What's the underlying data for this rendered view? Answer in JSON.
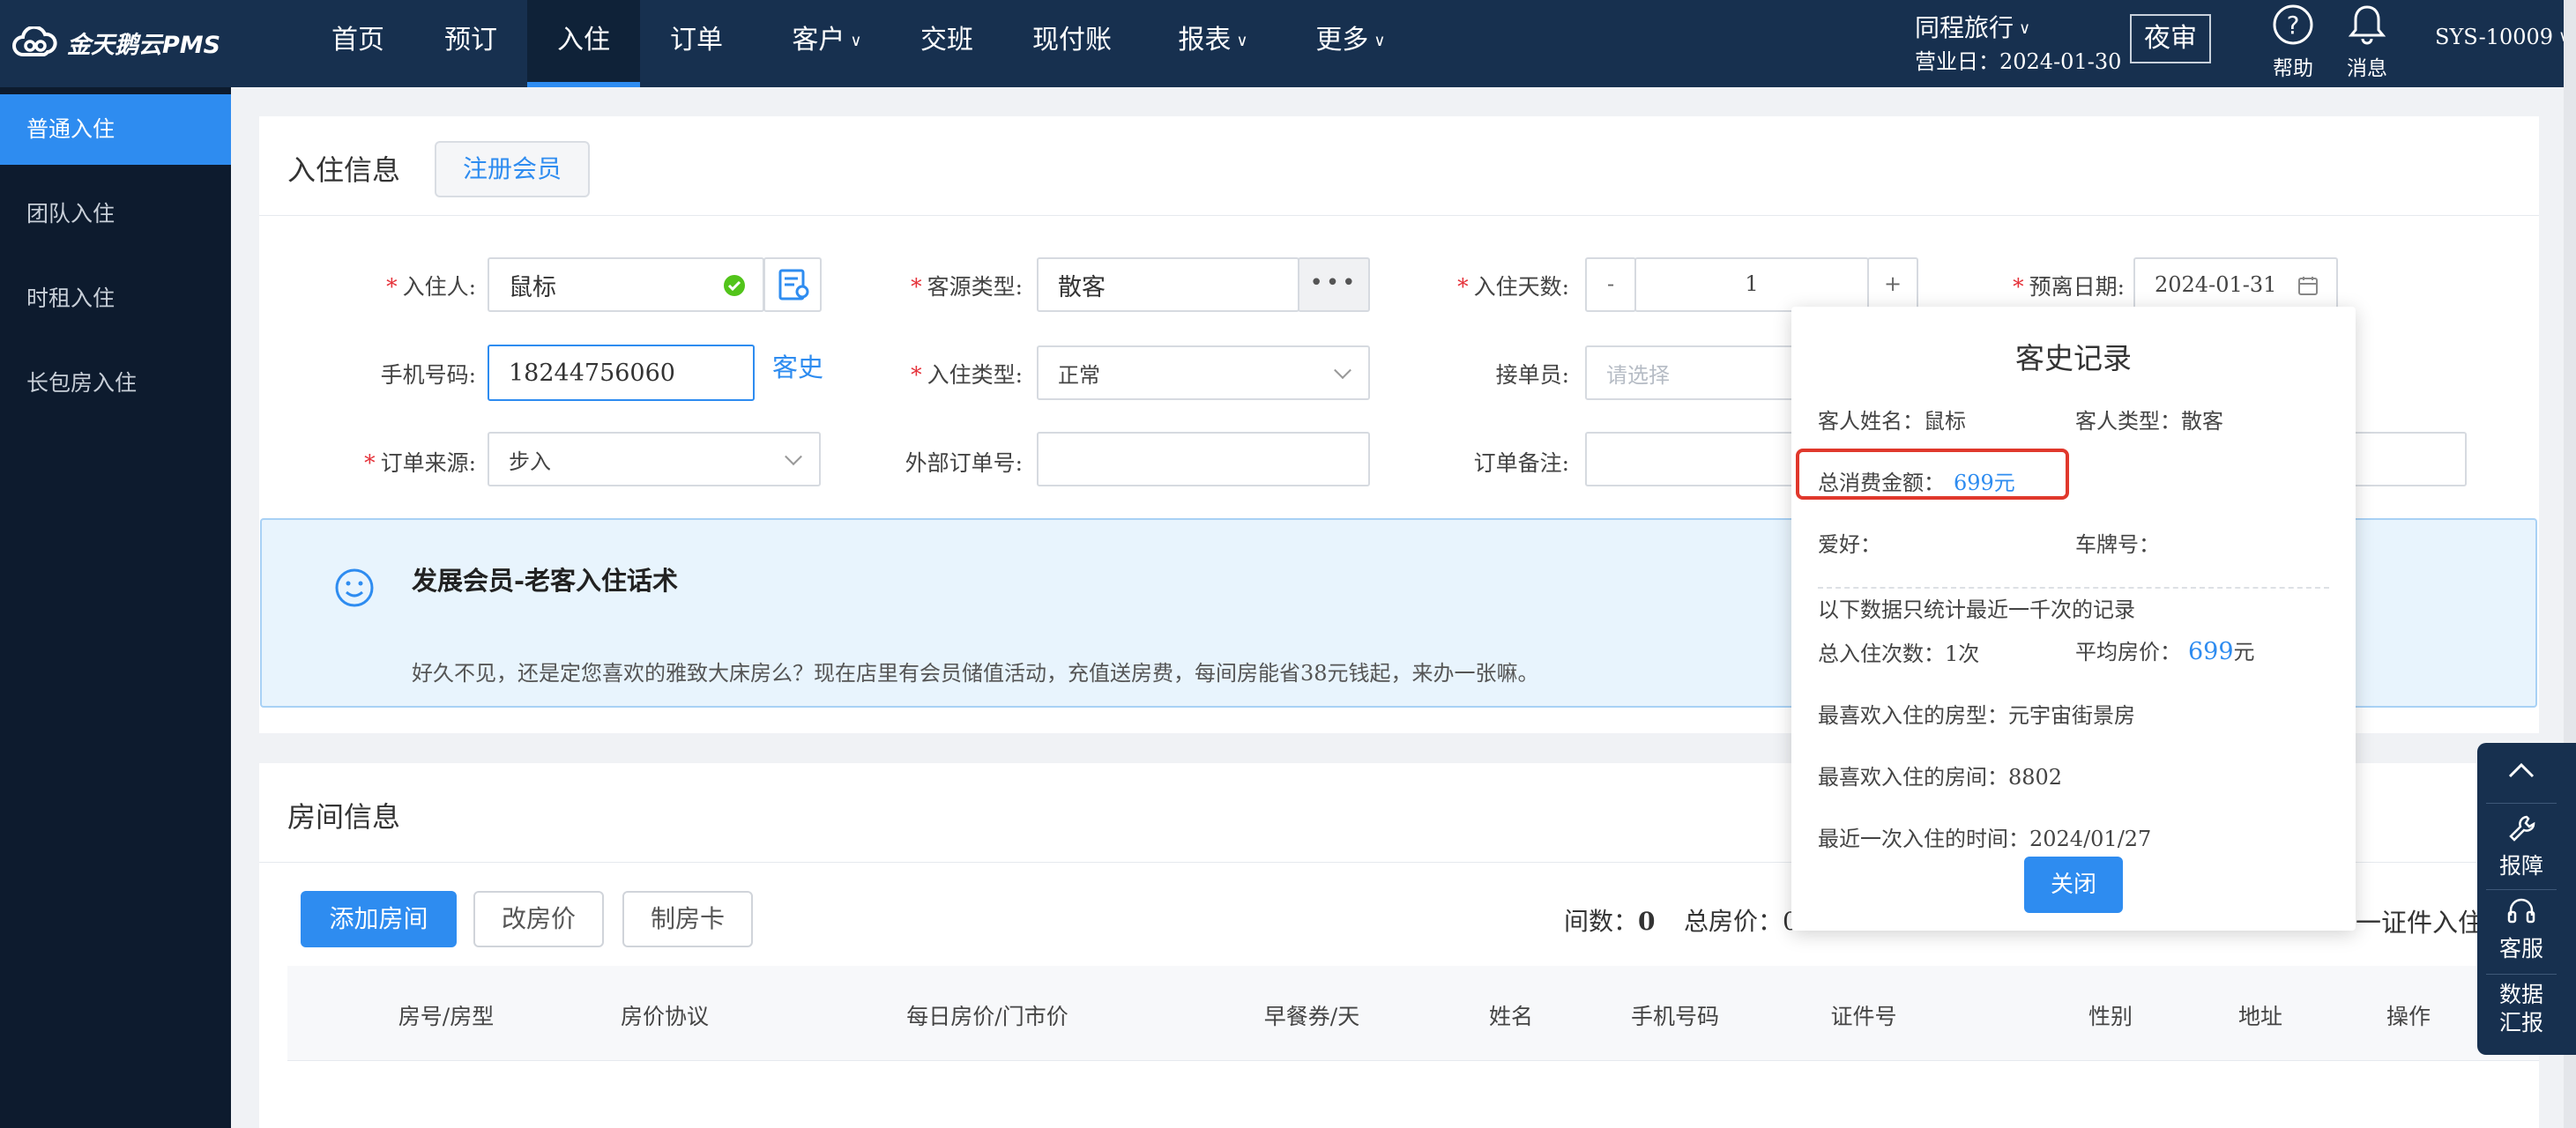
{
  "nav": {
    "logo": "金天鹅云PMS",
    "items": [
      {
        "label": "首页"
      },
      {
        "label": "预订"
      },
      {
        "label": "入住"
      },
      {
        "label": "订单"
      },
      {
        "label": "客户"
      },
      {
        "label": "交班"
      },
      {
        "label": "现付账"
      },
      {
        "label": "报表"
      },
      {
        "label": "更多"
      }
    ],
    "hotel": "同程旅行",
    "business_date_label": "营业日：2024-01-30",
    "night_audit": "夜审",
    "help": "帮助",
    "messages": "消息",
    "user": "SYS-10009"
  },
  "sidebar": {
    "items": [
      {
        "label": "普通入住"
      },
      {
        "label": "团队入住"
      },
      {
        "label": "时租入住"
      },
      {
        "label": "长包房入住"
      }
    ]
  },
  "checkin": {
    "title": "入住信息",
    "register_member": "注册会员",
    "guest_label": "入住人:",
    "guest_value": "鼠标",
    "source_type_label": "客源类型:",
    "source_type_value": "散客",
    "days_label": "入住天数:",
    "days_minus": "-",
    "days_value": "1",
    "days_plus": "+",
    "departure_label": "预离日期:",
    "departure_value": "2024-01-31",
    "phone_label": "手机号码:",
    "phone_value": "18244756060",
    "history_link": "客史",
    "checkin_type_label": "入住类型:",
    "checkin_type_value": "正常",
    "receiver_label": "接单员:",
    "receiver_placeholder": "请选择",
    "order_source_label": "订单来源:",
    "order_source_value": "步入",
    "external_order_label": "外部订单号:",
    "external_order_value": "",
    "order_remark_label": "订单备注:",
    "order_remark_value": ""
  },
  "banner": {
    "title": "发展会员-老客入住话术",
    "text": "好久不见，还是定您喜欢的雅致大床房么？现在店里有会员储值活动，充值送房费，每间房能省38元钱起，来办一张嘛。"
  },
  "rooms": {
    "title": "房间信息",
    "add_room": "添加房间",
    "change_price": "改房价",
    "make_card": "制房卡",
    "count_label": "间数：",
    "count_value": "0",
    "total_label": "总房价：",
    "total_value": "0",
    "id_checkin_tail": "一证件入住",
    "columns": [
      "房号/房型",
      "房价协议",
      "每日房价/门市价",
      "早餐券/天",
      "姓名",
      "手机号码",
      "证件号",
      "性别",
      "地址",
      "操作"
    ]
  },
  "history_popup": {
    "title": "客史记录",
    "guest_name_label": "客人姓名：",
    "guest_name_value": "鼠标",
    "guest_type_label": "客人类型：",
    "guest_type_value": "散客",
    "total_spend_label": "总消费金额：",
    "total_spend_value": "699元",
    "hobby_label": "爱好：",
    "plate_label": "车牌号：",
    "note": "以下数据只统计最近一千次的记录",
    "stays_label": "总入住次数：",
    "stays_value": "1次",
    "avg_price_label": "平均房价：",
    "avg_price_value": "699",
    "avg_price_unit": "元",
    "fav_room_type_label": "最喜欢入住的房型：",
    "fav_room_type_value": "元宇宙街景房",
    "fav_room_label": "最喜欢入住的房间：",
    "fav_room_value": "8802",
    "last_stay_label": "最近一次入住的时间：",
    "last_stay_value": "2024/01/27",
    "close": "关闭"
  },
  "float_panel": {
    "repair": "报障",
    "service": "客服",
    "report_line1": "数据",
    "report_line2": "汇报"
  },
  "colors": {
    "nav_bg": "#17304f",
    "accent": "#2e8cf0",
    "required": "#e5323a",
    "highlight_box": "#e0382c",
    "success": "#52c41a"
  }
}
